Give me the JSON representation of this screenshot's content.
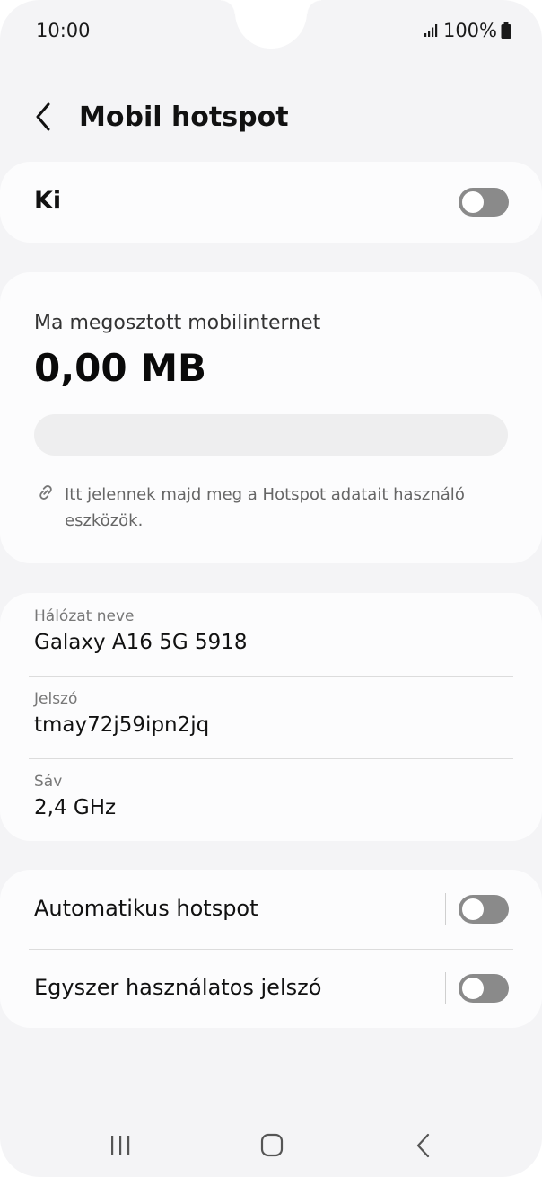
{
  "status_bar": {
    "time": "10:00",
    "battery": "100%"
  },
  "header": {
    "title": "Mobil hotspot"
  },
  "master_switch": {
    "label": "Ki",
    "enabled": false
  },
  "usage": {
    "label": "Ma megosztott mobilinternet",
    "value": "0,00 MB",
    "progress_fraction": 0,
    "hint": "Itt jelennek majd meg a Hotspot adatait használó eszközök."
  },
  "network": {
    "name_label": "Hálózat neve",
    "name_value": "Galaxy A16 5G 5918",
    "password_label": "Jelszó",
    "password_value": "tmay72j59ipn2jq",
    "band_label": "Sáv",
    "band_value": "2,4 GHz"
  },
  "options": [
    {
      "label": "Automatikus hotspot",
      "enabled": false
    },
    {
      "label": "Egyszer használatos jelszó",
      "enabled": false
    }
  ],
  "icons": {
    "signal": "signal-icon",
    "battery": "battery-icon",
    "back": "back-arrow-icon",
    "link": "link-icon",
    "nav_recents": "recents-icon",
    "nav_home": "home-icon",
    "nav_back": "nav-back-icon"
  },
  "colors": {
    "background": "#f4f4f6",
    "card": "#fcfcfd",
    "toggle_off": "#8a8a8a",
    "progress_track": "#eeeeef"
  }
}
